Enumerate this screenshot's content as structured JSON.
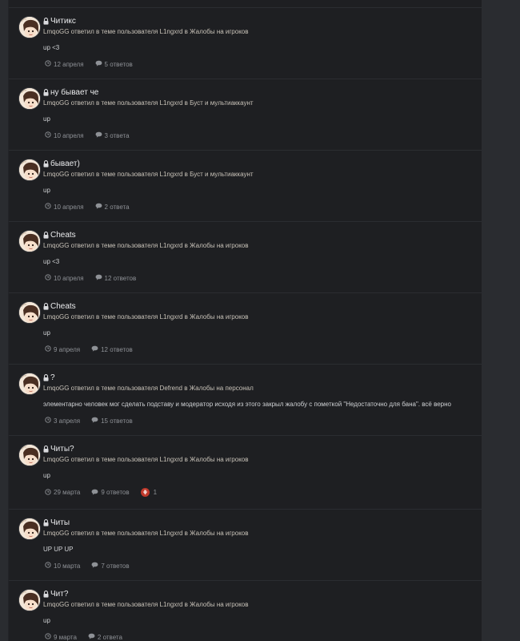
{
  "items": [
    {
      "title": "Читикс",
      "meta": "LmqoGG ответил в теме пользователя L1ngxrd в Жалобы на игроков",
      "body": "up <3",
      "date": "12 апреля",
      "replies": "5 ответов"
    },
    {
      "title": "ну бывает че",
      "meta": "LmqoGG ответил в теме пользователя L1ngxrd в Буст и мультиаккаунт",
      "body": "up",
      "date": "10 апреля",
      "replies": "3 ответа"
    },
    {
      "title": "бывает)",
      "meta": "LmqoGG ответил в теме пользователя L1ngxrd в Буст и мультиаккаунт",
      "body": "up",
      "date": "10 апреля",
      "replies": "2 ответа"
    },
    {
      "title": "Cheats",
      "meta": "LmqoGG ответил в теме пользователя L1ngxrd в Жалобы на игроков",
      "body": "up <3",
      "date": "10 апреля",
      "replies": "12 ответов"
    },
    {
      "title": "Cheats",
      "meta": "LmqoGG ответил в теме пользователя L1ngxrd в Жалобы на игроков",
      "body": "up",
      "date": "9 апреля",
      "replies": "12 ответов"
    },
    {
      "title": "?",
      "meta": "LmqoGG ответил в теме пользователя Defrend в Жалобы на персонал",
      "body": "элементарно человек мог сделать подставу и модератор исходя из этого закрыл жалобу с пометкой \"Недостаточно для бана\". всё верно",
      "date": "3 апреля",
      "replies": "15 ответов"
    },
    {
      "title": "Читы?",
      "meta": "LmqoGG ответил в теме пользователя L1ngxrd в Жалобы на игроков",
      "body": "up",
      "date": "29 марта",
      "replies": "9 ответов",
      "reaction_count": "1"
    },
    {
      "title": "Читы",
      "meta": "LmqoGG ответил в теме пользователя L1ngxrd в Жалобы на игроков",
      "body": "UP UP UP",
      "date": "10 марта",
      "replies": "7 ответов"
    },
    {
      "title": "Чит?",
      "meta": "LmqoGG ответил в теме пользователя L1ngxrd в Жалобы на игроков",
      "body": "up",
      "date": "9 марта",
      "replies": "2 ответа"
    }
  ],
  "colors": {
    "background": "#2a2c30",
    "feed": "#1e1f22",
    "reaction": "#c0392b"
  },
  "icons": {
    "lock": "lock-icon",
    "clock": "clock-icon",
    "comment": "comment-icon",
    "reaction": "dislike-reaction-icon"
  }
}
